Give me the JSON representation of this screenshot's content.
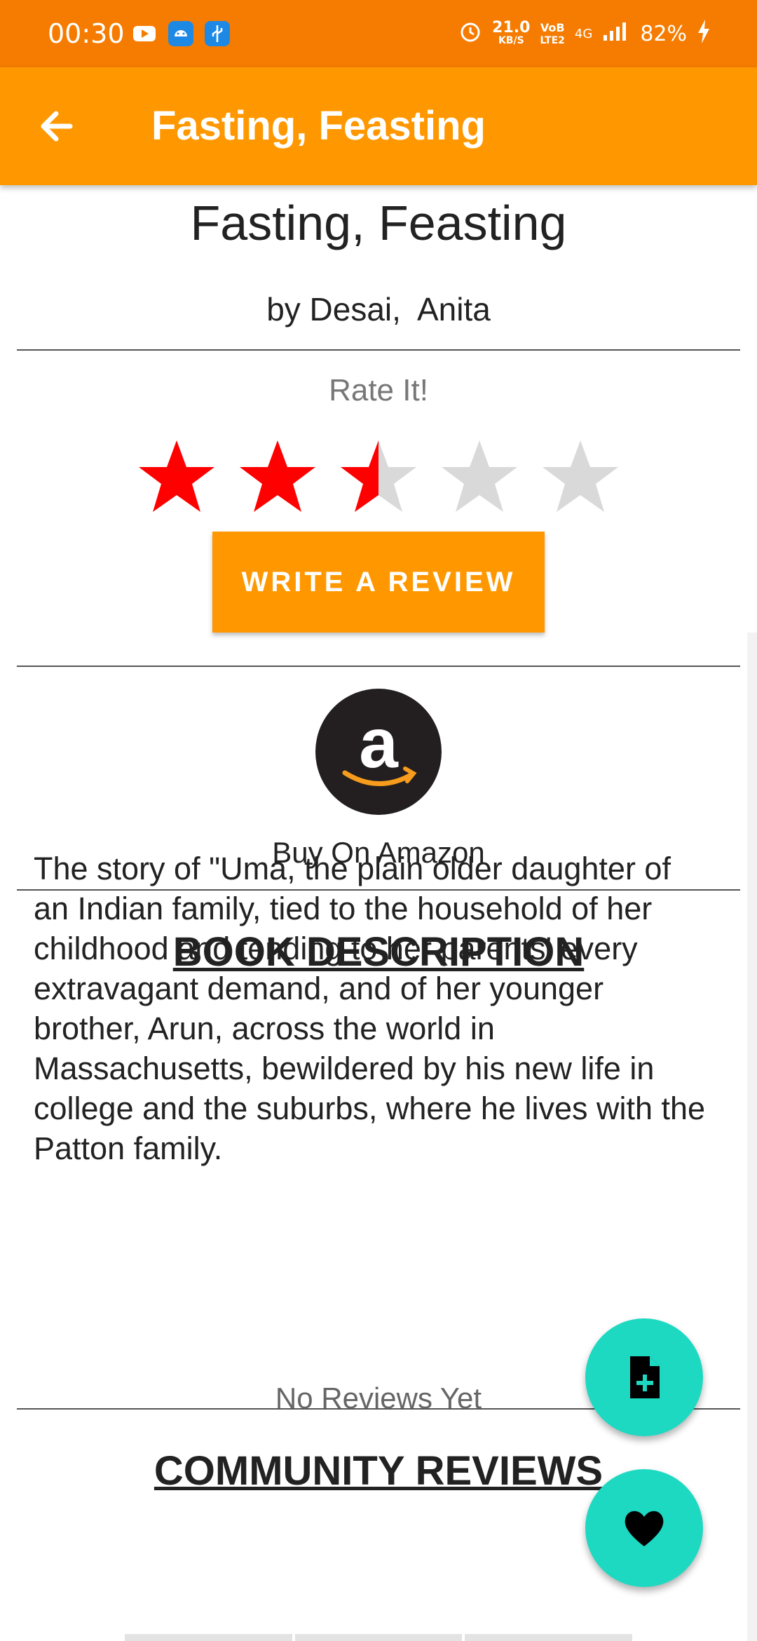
{
  "status_bar": {
    "time": "00:30",
    "net_speed_value": "21.0",
    "net_speed_unit": "KB/S",
    "volte_top": "VoB",
    "volte_bottom": "LTE2",
    "network": "4G",
    "battery": "82%"
  },
  "app_bar": {
    "title": "Fasting, Feasting",
    "back_icon": "arrow-back-icon"
  },
  "book": {
    "title": "Fasting, Feasting",
    "author": "by Desai,  Anita"
  },
  "rating": {
    "label": "Rate It!",
    "value": 2.5,
    "max": 5,
    "filled_color": "#FF0000",
    "empty_color": "#D9D9D9"
  },
  "review_button": {
    "label": "WRITE A REVIEW"
  },
  "amazon": {
    "label": "Buy On Amazon",
    "icon": "amazon-icon"
  },
  "description": {
    "heading": "BOOK DESCRIPTION",
    "text": "The story of \"Uma, the plain older daughter of an Indian family, tied to the household of her childhood and tending to her parents' every extravagant demand, and of her younger brother, Arun, across the world in Massachusetts, bewildered by his new life in college and the suburbs, where he lives with the Patton family."
  },
  "reviews": {
    "heading": "COMMUNITY REVIEWS",
    "empty_text": "No Reviews Yet"
  },
  "fabs": [
    {
      "icon": "note-add-icon"
    },
    {
      "icon": "heart-icon"
    }
  ],
  "colors": {
    "status_bar": "#F57C00",
    "app_bar": "#FF9800",
    "button": "#FF9800",
    "fab": "#1DD9C2"
  }
}
